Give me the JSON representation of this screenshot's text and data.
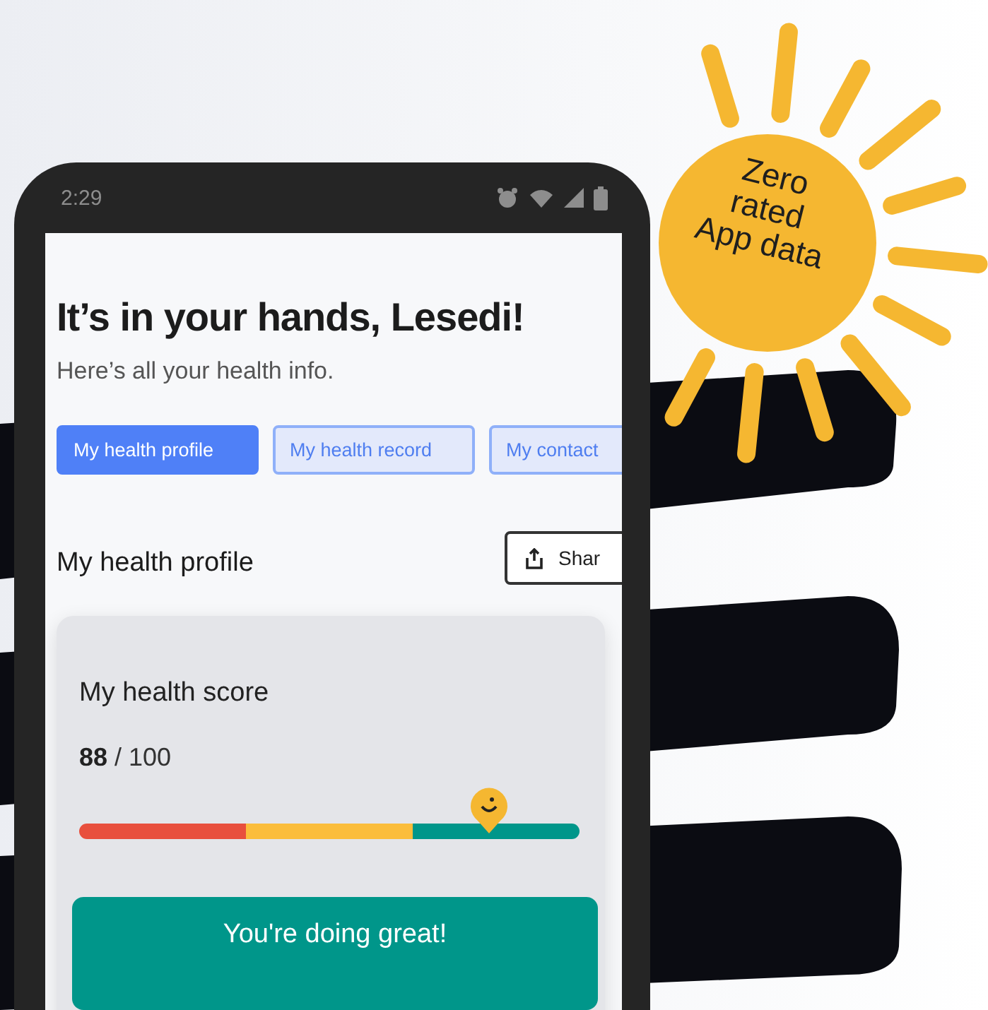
{
  "status_bar": {
    "time": "2:29"
  },
  "header": {
    "title": "It’s in your hands, Lesedi!",
    "subtitle": "Here’s all your health info."
  },
  "tabs": [
    {
      "label": "My health profile",
      "selected": true
    },
    {
      "label": "My health record",
      "selected": false
    },
    {
      "label": "My contact",
      "selected": false
    }
  ],
  "section": {
    "title": "My health profile",
    "share_button": "Shar"
  },
  "score_card": {
    "title": "My health score",
    "score": "88",
    "total": " / 100",
    "level": 0.82,
    "banner": "You're doing great!"
  },
  "badge": {
    "lines": [
      "Zero",
      "rated",
      "App data"
    ]
  }
}
